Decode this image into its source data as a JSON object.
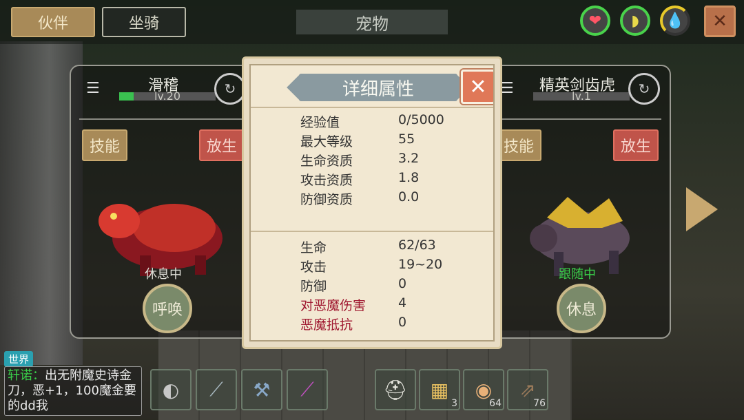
{
  "tabs": {
    "partner": "伙伴",
    "mount": "坐骑"
  },
  "screen_title": "宠物",
  "status_icons": [
    "heart-icon",
    "food-icon",
    "water-icon"
  ],
  "left_pet": {
    "name": "滑稽",
    "level": "lv.20",
    "level_fill": 0.15,
    "skill_btn": "技能",
    "release_btn": "放生",
    "status": "休息中",
    "action_btn": "呼唤"
  },
  "right_pet": {
    "name": "精英剑齿虎",
    "level": "lv.1",
    "skill_btn": "技能",
    "release_btn": "放生",
    "status": "跟随中",
    "action_btn": "休息"
  },
  "dialog": {
    "title": "详细属性",
    "group1": [
      {
        "label": "经验值",
        "value": "0/5000"
      },
      {
        "label": "最大等级",
        "value": "55"
      },
      {
        "label": "生命资质",
        "value": "3.2"
      },
      {
        "label": "攻击资质",
        "value": "1.8"
      },
      {
        "label": "防御资质",
        "value": "0.0"
      }
    ],
    "group2": [
      {
        "label": "生命",
        "value": "62/63"
      },
      {
        "label": "攻击",
        "value": "19~20"
      },
      {
        "label": "防御",
        "value": "0"
      },
      {
        "label": "对恶魔伤害",
        "value": "4"
      },
      {
        "label": "恶魔抵抗",
        "value": "0"
      }
    ]
  },
  "chat": {
    "channel": "世界",
    "user": "轩诺",
    "message": "出无附魔史诗金刀，恶+1，100魔金要的dd我"
  },
  "hotbar": {
    "slots": [
      {
        "icon": "disc-icon",
        "count": ""
      },
      {
        "icon": "spear-icon",
        "count": ""
      },
      {
        "icon": "axe-icon",
        "count": ""
      },
      {
        "icon": "staff-icon",
        "count": ""
      },
      {
        "icon": "helmet-icon",
        "count": ""
      },
      {
        "icon": "popcorn-icon",
        "count": "3"
      },
      {
        "icon": "dumpling-icon",
        "count": "64"
      },
      {
        "icon": "arrows-icon",
        "count": "76"
      }
    ]
  },
  "colors": {
    "accent_green": "#3ad04a",
    "danger_red": "#a01830",
    "tab_gold": "#a88a58"
  }
}
